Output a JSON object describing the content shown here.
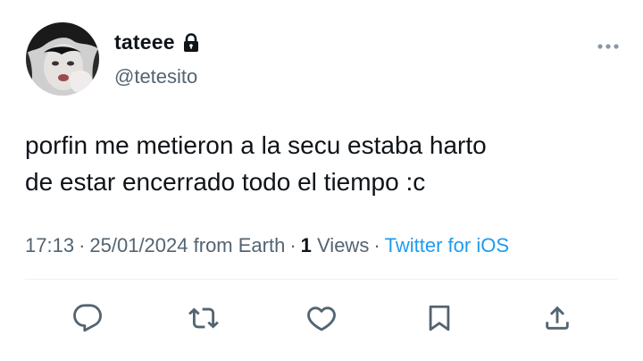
{
  "author": {
    "display_name": "tateee",
    "handle": "@tetesito",
    "protected_icon": "lock-icon",
    "avatar_icon": "avatar-photo"
  },
  "tweet": {
    "text": "porfin me metieron a la secu estaba harto\nde estar encerrado todo el tiempo :c"
  },
  "meta": {
    "time": "17:13",
    "date": "25/01/2024",
    "location": "from Earth",
    "views_count": "1",
    "views_label": "Views",
    "source": "Twitter for iOS",
    "separator": "·"
  },
  "actions": [
    {
      "icon": "reply-icon"
    },
    {
      "icon": "retweet-icon"
    },
    {
      "icon": "like-icon"
    },
    {
      "icon": "bookmark-icon"
    },
    {
      "icon": "share-icon"
    }
  ],
  "colors": {
    "text": "#0f1419",
    "secondary": "#536471",
    "link": "#1d9bf0",
    "divider": "#eff3f4"
  }
}
